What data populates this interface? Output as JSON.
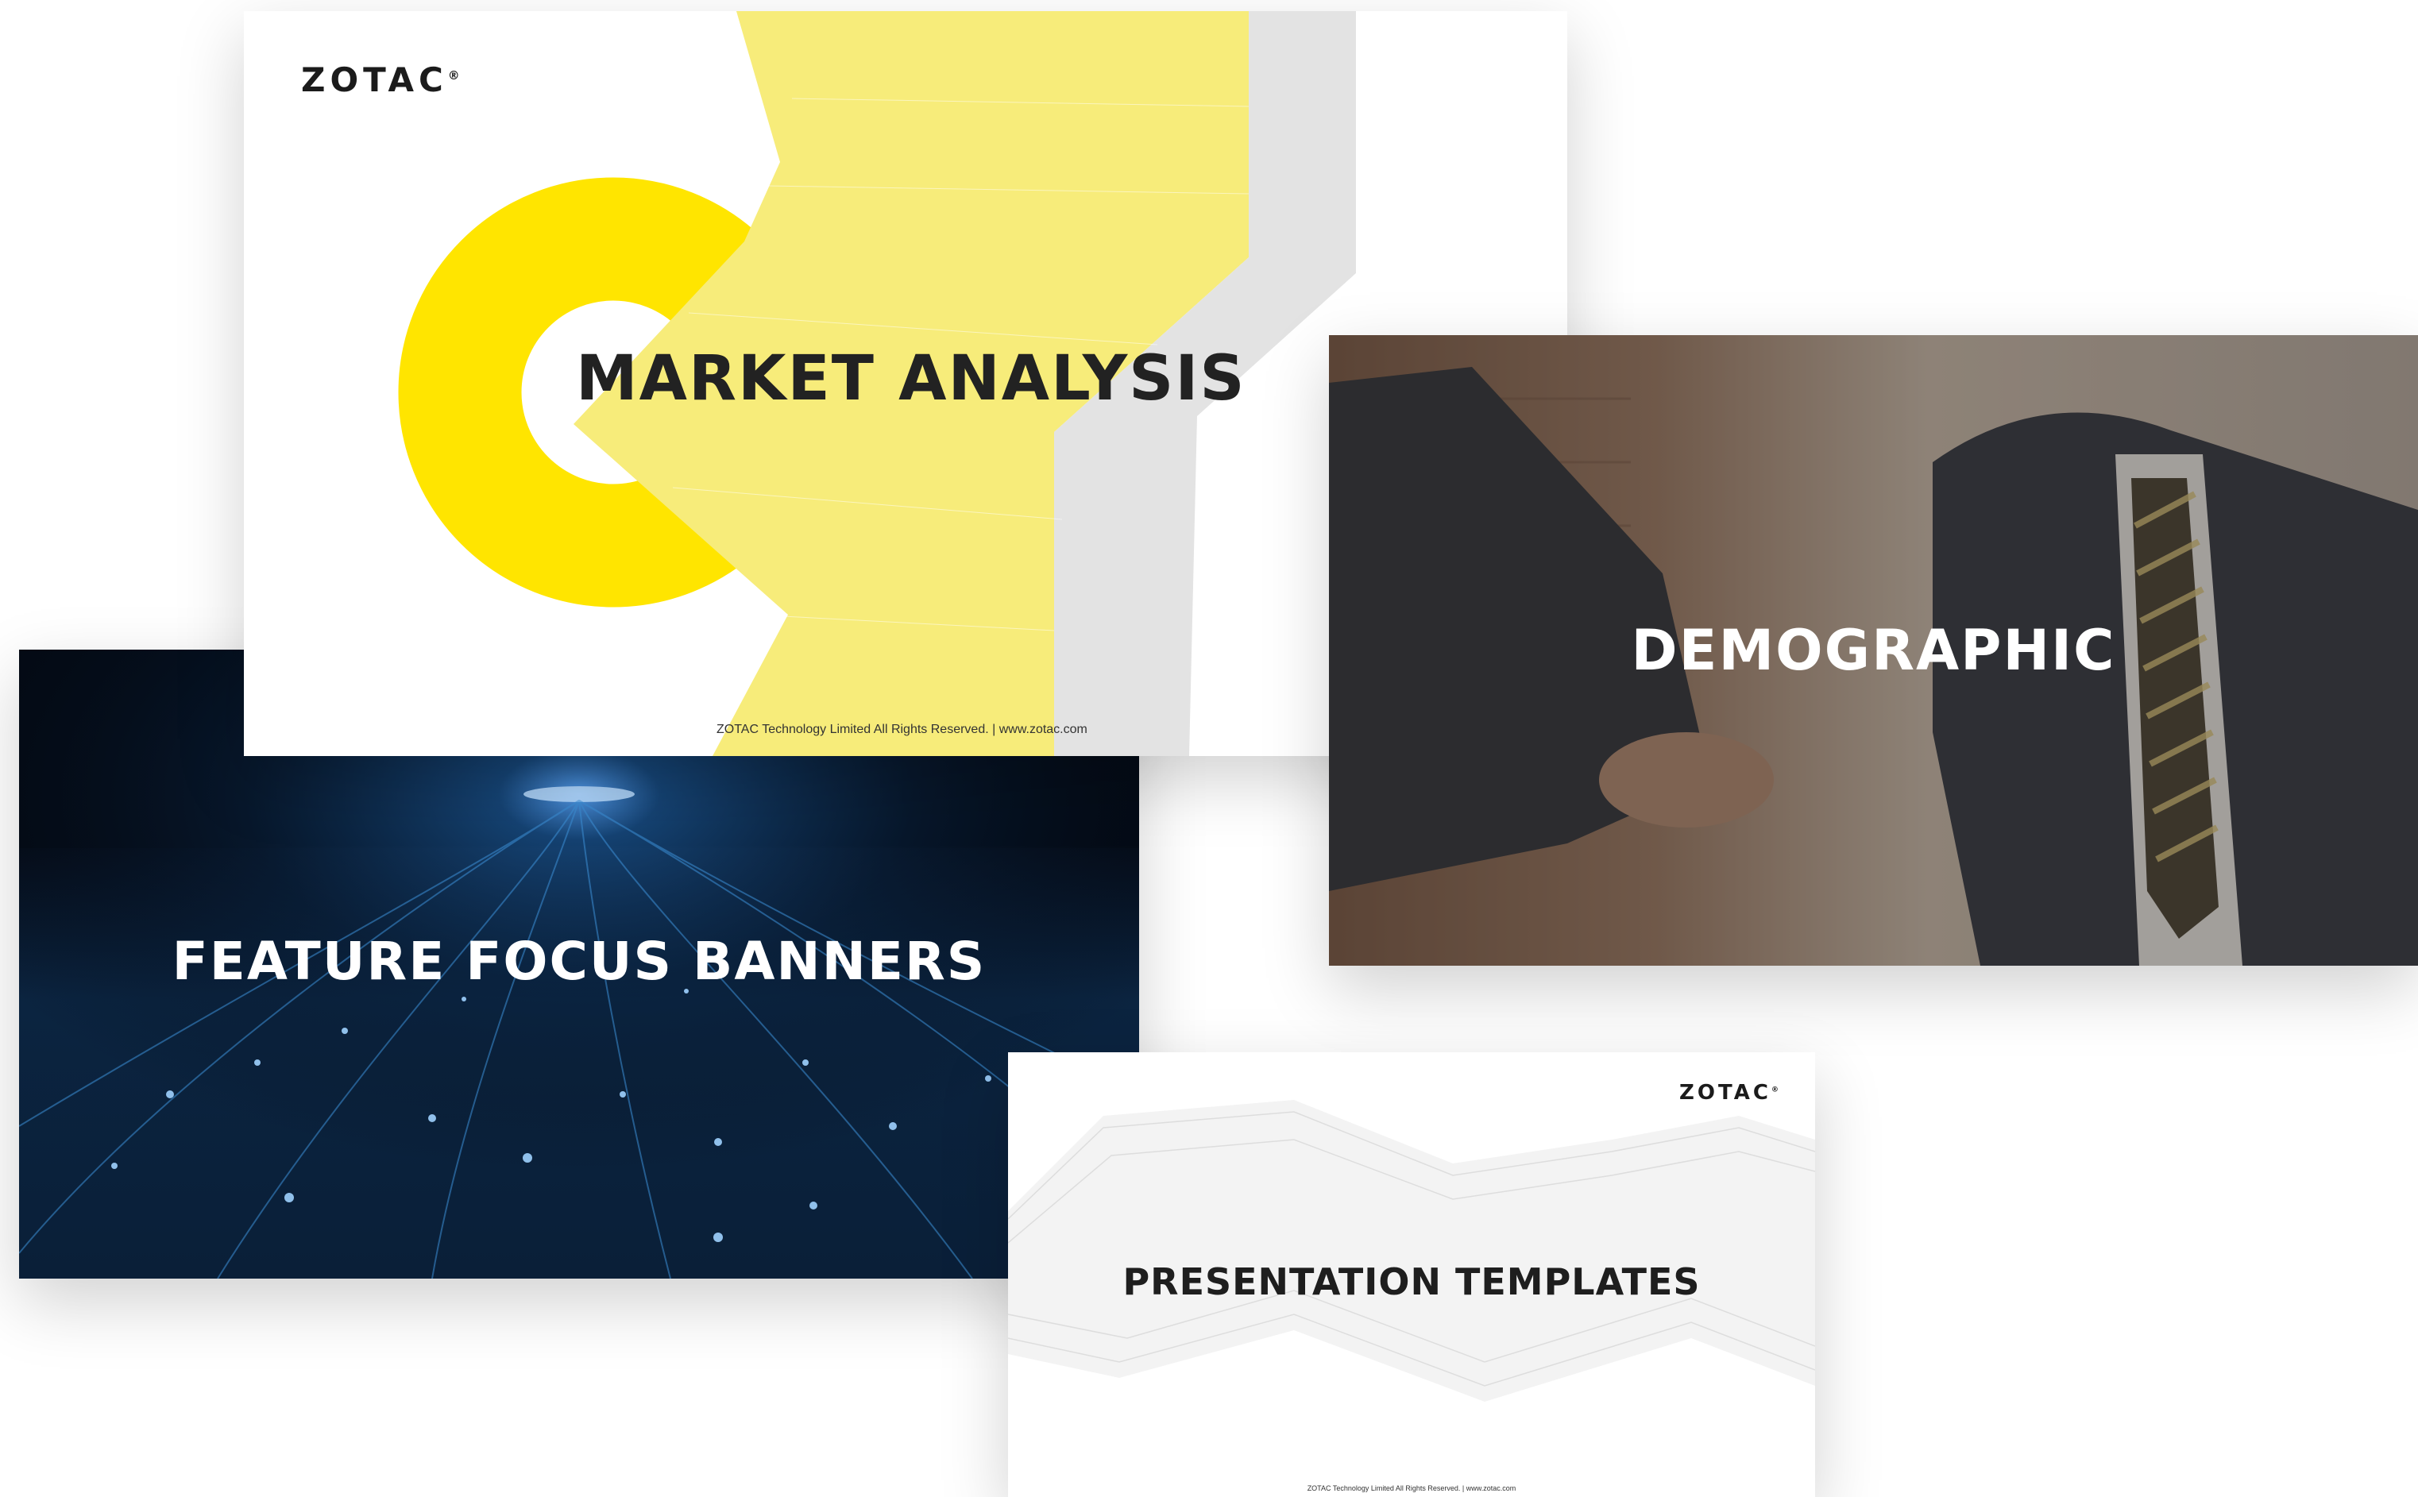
{
  "colors": {
    "accent_yellow": "#ffe500",
    "dark_banner": "#07101e",
    "glow_blue": "#4fa8ff",
    "title_dark": "#222222",
    "title_light": "#ffffff"
  },
  "cards": {
    "market": {
      "logo": "ZOTAC",
      "logo_mark": "®",
      "title": "MARKET ANALYSIS",
      "footer": "ZOTAC Technology Limited All Rights Reserved.  |   www.zotac.com"
    },
    "demographic": {
      "title": "DEMOGRAPHIC",
      "image": "handshake-photo"
    },
    "feature": {
      "title": "FEATURE FOCUS BANNERS",
      "image": "night-highway-lights"
    },
    "presentation": {
      "logo": "ZOTAC",
      "logo_mark": "®",
      "title": "PRESENTATION TEMPLATES",
      "footer": "ZOTAC Technology Limited All Rights Reserved.  |  www.zotac.com"
    }
  }
}
